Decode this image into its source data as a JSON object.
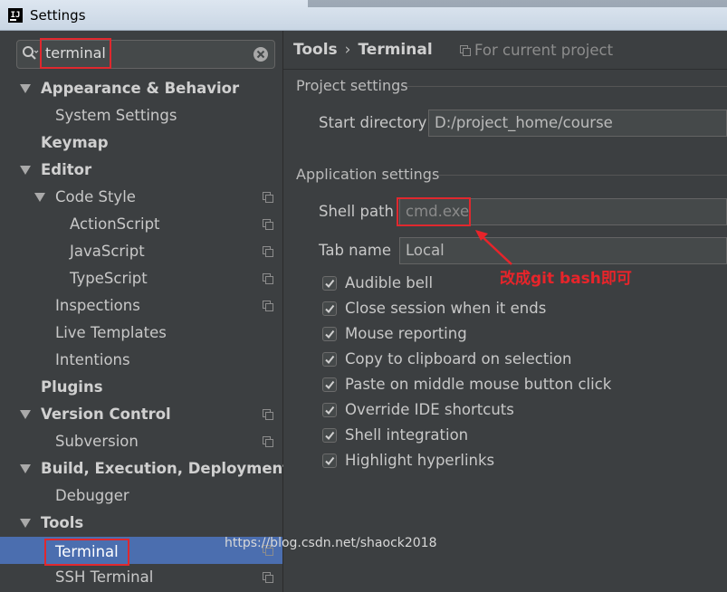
{
  "window": {
    "title": "Settings"
  },
  "search": {
    "value": "terminal"
  },
  "tree": [
    {
      "label": "Appearance & Behavior",
      "bold": true,
      "arrow": true,
      "indent": 0,
      "copy": false
    },
    {
      "label": "System Settings",
      "bold": false,
      "arrow": false,
      "indent": 1,
      "copy": false
    },
    {
      "label": "Keymap",
      "bold": true,
      "arrow": false,
      "indent": 0,
      "copy": false
    },
    {
      "label": "Editor",
      "bold": true,
      "arrow": true,
      "indent": 0,
      "copy": false
    },
    {
      "label": "Code Style",
      "bold": false,
      "arrow": true,
      "indent": 1,
      "copy": true
    },
    {
      "label": "ActionScript",
      "bold": false,
      "arrow": false,
      "indent": 2,
      "copy": true
    },
    {
      "label": "JavaScript",
      "bold": false,
      "arrow": false,
      "indent": 2,
      "copy": true
    },
    {
      "label": "TypeScript",
      "bold": false,
      "arrow": false,
      "indent": 2,
      "copy": true
    },
    {
      "label": "Inspections",
      "bold": false,
      "arrow": false,
      "indent": 1,
      "copy": true
    },
    {
      "label": "Live Templates",
      "bold": false,
      "arrow": false,
      "indent": 1,
      "copy": false
    },
    {
      "label": "Intentions",
      "bold": false,
      "arrow": false,
      "indent": 1,
      "copy": false
    },
    {
      "label": "Plugins",
      "bold": true,
      "arrow": false,
      "indent": 0,
      "copy": false
    },
    {
      "label": "Version Control",
      "bold": true,
      "arrow": true,
      "indent": 0,
      "copy": true
    },
    {
      "label": "Subversion",
      "bold": false,
      "arrow": false,
      "indent": 1,
      "copy": true
    },
    {
      "label": "Build, Execution, Deployment",
      "bold": true,
      "arrow": true,
      "indent": 0,
      "copy": false
    },
    {
      "label": "Debugger",
      "bold": false,
      "arrow": false,
      "indent": 1,
      "copy": false
    },
    {
      "label": "Tools",
      "bold": true,
      "arrow": true,
      "indent": 0,
      "copy": false
    },
    {
      "label": "Terminal",
      "bold": false,
      "arrow": false,
      "indent": 1,
      "copy": true,
      "selected": true
    },
    {
      "label": "SSH Terminal",
      "bold": false,
      "arrow": false,
      "indent": 1,
      "copy": true
    }
  ],
  "breadcrumb": {
    "parent": "Tools",
    "separator": "›",
    "current": "Terminal",
    "scope": "For current project"
  },
  "project_settings": {
    "title": "Project settings",
    "start_directory_label": "Start directory",
    "start_directory_value": "D:/project_home/course"
  },
  "application_settings": {
    "title": "Application settings",
    "shell_path_label": "Shell path",
    "shell_path_value": "cmd.exe",
    "tab_name_label": "Tab name",
    "tab_name_value": "Local"
  },
  "options": [
    {
      "label": "Audible bell",
      "checked": true
    },
    {
      "label": "Close session when it ends",
      "checked": true
    },
    {
      "label": "Mouse reporting",
      "checked": true
    },
    {
      "label": "Copy to clipboard on selection",
      "checked": true
    },
    {
      "label": "Paste on middle mouse button click",
      "checked": true
    },
    {
      "label": "Override IDE shortcuts",
      "checked": true
    },
    {
      "label": "Shell integration",
      "checked": true
    },
    {
      "label": "Highlight hyperlinks",
      "checked": true
    }
  ],
  "annotation": {
    "text": "改成git bash即可",
    "color": "#e8242a"
  },
  "watermark": "https://blog.csdn.net/shaock2018",
  "colors": {
    "selection": "#4b6eaf",
    "panel": "#3c3f41",
    "highlight": "#e0282e"
  }
}
